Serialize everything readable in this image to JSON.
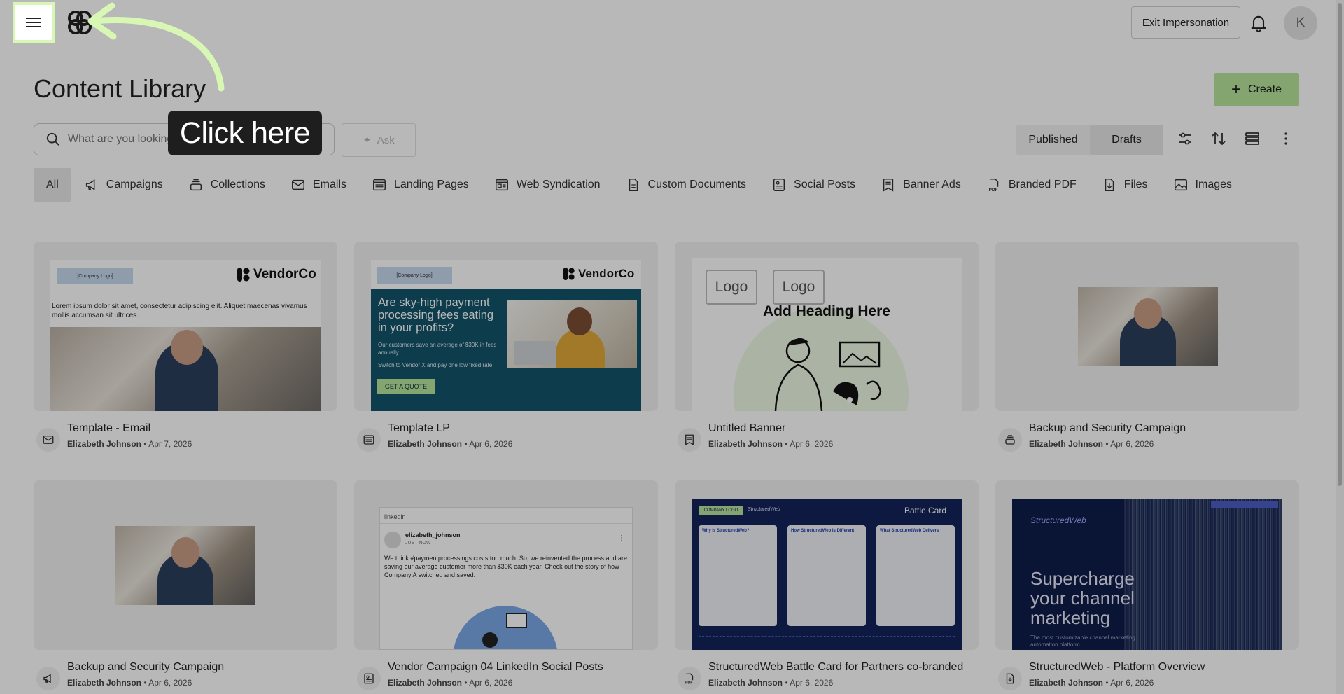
{
  "header": {
    "exit_label": "Exit Impersonation",
    "avatar_initial": "K"
  },
  "page": {
    "title": "Content Library",
    "create_label": "Create"
  },
  "search": {
    "placeholder": "What are you looking for?",
    "ask_label": "Ask"
  },
  "status_toggle": {
    "published": "Published",
    "drafts": "Drafts",
    "active": "Drafts"
  },
  "filters": [
    "All",
    "Campaigns",
    "Collections",
    "Emails",
    "Landing Pages",
    "Web Syndication",
    "Custom Documents",
    "Social Posts",
    "Banner Ads",
    "Branded PDF",
    "Files",
    "Images"
  ],
  "cards": [
    {
      "name": "Template - Email",
      "author": "Elizabeth Johnson",
      "date": "Apr 7, 2026",
      "type_icon": "mail-icon"
    },
    {
      "name": "Template LP",
      "author": "Elizabeth Johnson",
      "date": "Apr 6, 2026",
      "type_icon": "landing-page-icon"
    },
    {
      "name": "Untitled Banner",
      "author": "Elizabeth Johnson",
      "date": "Apr 6, 2026",
      "type_icon": "banner-icon"
    },
    {
      "name": "Backup and Security Campaign",
      "author": "Elizabeth Johnson",
      "date": "Apr 6, 2026",
      "type_icon": "collection-icon"
    },
    {
      "name": "Backup and Security Campaign",
      "author": "Elizabeth Johnson",
      "date": "Apr 6, 2026",
      "type_icon": "campaign-icon"
    },
    {
      "name": "Vendor Campaign 04 LinkedIn Social Posts",
      "author": "Elizabeth Johnson",
      "date": "Apr 6, 2026",
      "type_icon": "social-icon"
    },
    {
      "name": "StructuredWeb Battle Card for Partners co-branded",
      "author": "Elizabeth Johnson",
      "date": "Apr 6, 2026",
      "type_icon": "pdf-icon"
    },
    {
      "name": "StructuredWeb - Platform Overview",
      "author": "Elizabeth Johnson",
      "date": "Apr 6, 2026",
      "type_icon": "file-icon"
    }
  ],
  "previews": {
    "email": {
      "company_logo": "[Company Logo]",
      "brand": "VendorCo",
      "body": "Lorem ipsum dolor sit amet, consectetur adipiscing elit. Aliquet maecenas vivamus mollis accumsan sit ultrices."
    },
    "lp": {
      "company_logo": "[Company Logo]",
      "brand": "VendorCo",
      "headline": "Are sky-high payment processing fees eating in your profits?",
      "line1": "Our customers save an average of $30K in fees annually",
      "line2": "Switch to Vendor X and pay one low fixed rate.",
      "cta": "GET A QUOTE"
    },
    "banner": {
      "logo1": "Logo",
      "logo2": "Logo",
      "heading": "Add Heading Here"
    },
    "linkedin": {
      "network": "linkedin",
      "user": "elizabeth_johnson",
      "time": "JUST NOW",
      "text": "We think #paymentprocessings costs too much. So, we reinvented the process and are saving our average customer more than $30K each year. Check out the story of how Company A switched and saved."
    },
    "battlecard": {
      "title": "Battle Card",
      "logo": "COMPANY LOGO",
      "brand": "StructuredWeb",
      "col1": "Why is StructuredWeb?",
      "col2": "How StructuredWeb Is Different",
      "col3": "What StructuredWeb Delivers"
    },
    "overview": {
      "brand": "StructuredWeb",
      "headline": "Supercharge your channel marketing",
      "sub": "The most customizable channel marketing automation platform"
    }
  },
  "tutorial": {
    "tooltip": "Click here"
  },
  "colors": {
    "accent_green": "#b7e59a",
    "highlight": "#d8f7b4",
    "lp_teal": "#13546a",
    "navy": "#0f1d4a"
  }
}
